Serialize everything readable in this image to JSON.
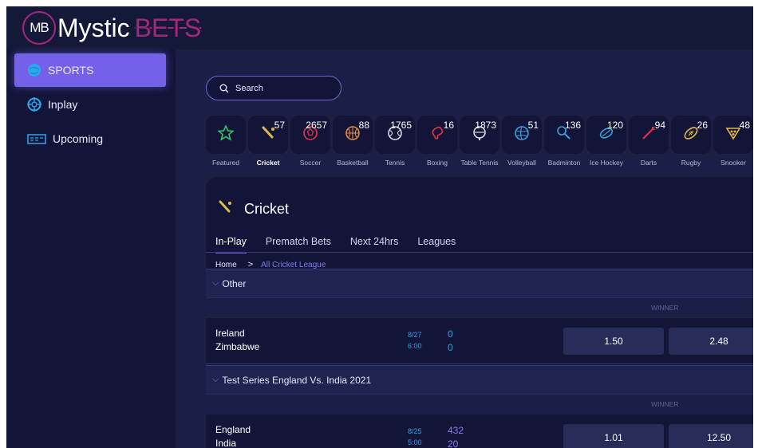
{
  "header": {
    "logo_badge": "MB",
    "logo_text_primary": "Mystic",
    "logo_text_accent": "BETS"
  },
  "sidebar": {
    "items": [
      {
        "label": "SPORTS",
        "icon": "globe-icon",
        "active": true
      },
      {
        "label": "Inplay",
        "icon": "target-icon",
        "active": false
      },
      {
        "label": "Upcoming",
        "icon": "calendar-icon",
        "active": false
      }
    ]
  },
  "search": {
    "placeholder": "Search"
  },
  "sports": [
    {
      "label": "Featured",
      "count": "",
      "icon": "star-icon"
    },
    {
      "label": "Cricket",
      "count": "57",
      "icon": "cricket-bat-icon",
      "active": true
    },
    {
      "label": "Soccer",
      "count": "2657",
      "icon": "soccer-ball-icon"
    },
    {
      "label": "Basketball",
      "count": "88",
      "icon": "basketball-icon"
    },
    {
      "label": "Tennis",
      "count": "1765",
      "icon": "tennis-ball-icon"
    },
    {
      "label": "Boxing",
      "count": "16",
      "icon": "boxing-glove-icon"
    },
    {
      "label": "Table Tennis",
      "count": "1873",
      "icon": "table-tennis-icon"
    },
    {
      "label": "Volleyball",
      "count": "51",
      "icon": "volleyball-icon"
    },
    {
      "label": "Badminton",
      "count": "136",
      "icon": "shuttlecock-icon"
    },
    {
      "label": "Ice Hockey",
      "count": "120",
      "icon": "hockey-puck-icon"
    },
    {
      "label": "Darts",
      "count": "94",
      "icon": "dart-icon"
    },
    {
      "label": "Rugby",
      "count": "26",
      "icon": "rugby-ball-icon"
    },
    {
      "label": "Snooker",
      "count": "48",
      "icon": "snooker-icon"
    }
  ],
  "panel": {
    "title": "Cricket",
    "tabs": [
      "In-Play",
      "Prematch Bets",
      "Next 24hrs",
      "Leagues"
    ],
    "breadcrumb": {
      "home": "Home",
      "separator": ">",
      "current": "All Cricket League"
    },
    "groups": [
      {
        "name": "Other",
        "winner_label": "WINNER",
        "matches": [
          {
            "team1": "Ireland",
            "team2": "Zimbabwe",
            "date": "8/27",
            "time": "6:00",
            "score1": "0",
            "score2": "0",
            "odds": [
              "1.50",
              "2.48"
            ]
          }
        ]
      },
      {
        "name": "Test Series England Vs. India 2021",
        "winner_label": "WINNER",
        "matches": [
          {
            "team1": "England",
            "team2": "India",
            "date": "8/25",
            "time": "5:00",
            "score1": "432",
            "score2": "20",
            "odds": [
              "1.01",
              "12.50"
            ]
          }
        ]
      }
    ]
  },
  "colors": {
    "background": "#161a3e",
    "sidebar": "#121538",
    "accent": "#7561e8",
    "brand": "#a3267f",
    "link": "#7e7bf0",
    "score": "#3aa0e0"
  }
}
